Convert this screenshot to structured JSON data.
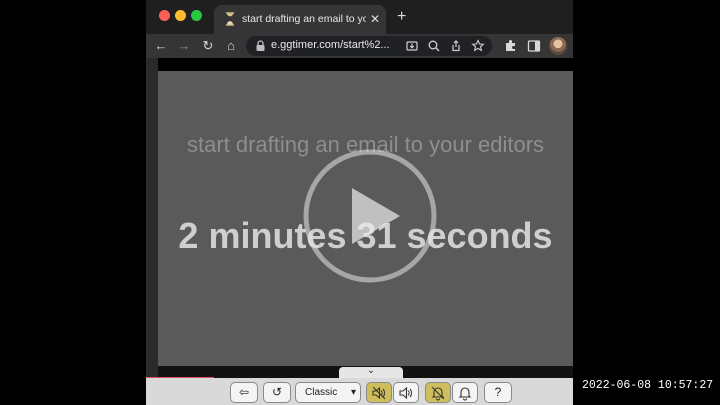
{
  "browser": {
    "tab": {
      "title": "start drafting an email to your editors",
      "close_glyph": "✕",
      "favicon_icon": "ggtimer-favicon"
    },
    "new_tab_glyph": "+",
    "toolbar": {
      "back_glyph": "←",
      "forward_glyph": "→",
      "reload_glyph": "↻",
      "home_glyph": "⌂"
    },
    "address": {
      "url": "e.ggtimer.com/start%2..."
    }
  },
  "timer": {
    "message": "start drafting an email to your editors",
    "time_remaining": "2 minutes 31 seconds",
    "progress_fraction": 0.16
  },
  "controls": {
    "collapse_glyph": "⌄",
    "back_glyph": "⇦",
    "restart_glyph": "↺",
    "theme_selected": "Classic",
    "select_arrow": "▾",
    "help_glyph": "?"
  },
  "overlay": {
    "timestamp": "2022-06-08 10:57:27"
  },
  "colors": {
    "timer_panel": "#5a5a5a",
    "active_toggle": "#cfbf5c",
    "progress_bar": "#d94f5c"
  }
}
